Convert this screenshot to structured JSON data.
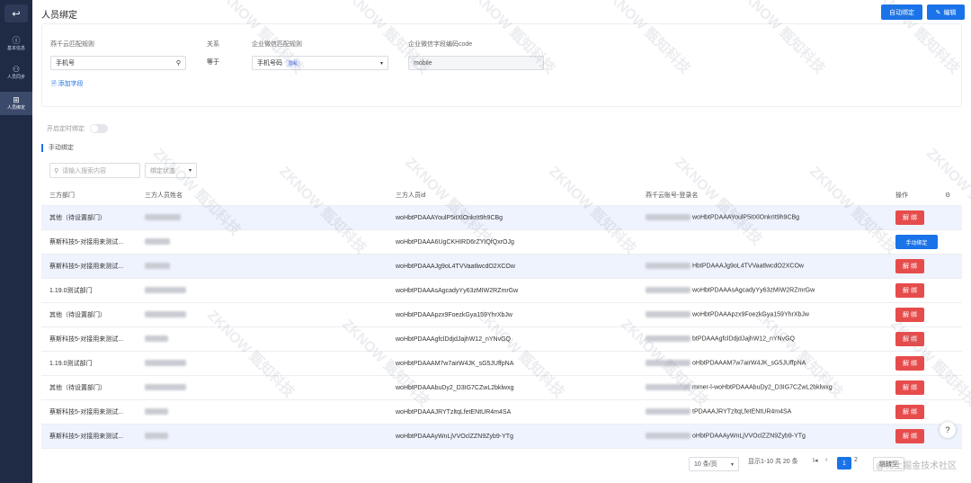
{
  "rail": {
    "back_icon": "↩",
    "items": [
      {
        "icon": "ⓘ",
        "label": "基本信息"
      },
      {
        "icon": "⚇",
        "label": "人员同步"
      },
      {
        "icon": "⊞",
        "label": "人员绑定"
      }
    ]
  },
  "header": {
    "title": "人员绑定",
    "auto_bind_label": "自动绑定",
    "edit_label": "编辑"
  },
  "rule": {
    "left_label": "燕千云匹配规则",
    "left_value": "手机号",
    "relation_label": "关系",
    "relation_value": "等于",
    "wecom_label": "企业微信匹配规则",
    "wecom_value": "手机号码",
    "wecom_tag": "隐私",
    "code_label": "企业微信字段编码code",
    "code_value": "mobile",
    "add_field_label": "添加字段"
  },
  "timer_label": "开启定时绑定",
  "section_title": "手动绑定",
  "filters": {
    "search_placeholder": "请输入搜索内容",
    "status_label": "绑定状态"
  },
  "table": {
    "headers": [
      "三方部门",
      "三方人员姓名",
      "三方人员id",
      "燕千云账号-登录名",
      "操作"
    ],
    "rows": [
      {
        "dept": "其他（待设置部门）",
        "name_w": 40,
        "id": "woHbtPDAAAYoulP5itXlOnkrIt9h9CBg",
        "acc_w": 50,
        "acc": "woHbtPDAAAYoulP5itXlOnkrIt9h9CBg",
        "action": "解 绑",
        "alt": true
      },
      {
        "dept": "蔡斯科技5-对接用来测试...",
        "name_w": 28,
        "id": "woHbtPDAAA6UgCKHIRD6rZYIQfQxrOJg",
        "acc_w": 0,
        "acc": "",
        "action": "手动绑定",
        "alt": false
      },
      {
        "dept": "蔡斯科技5-对接用来测试...",
        "name_w": 28,
        "id": "woHbtPDAAAJg9oL4TVVaatlwcdO2XCOw",
        "acc_w": 50,
        "acc": "HbtPDAAAJg9oL4TVVaatlwcdO2XCOw",
        "action": "解 绑",
        "alt": true
      },
      {
        "dept": "1.19.0测试部门",
        "name_w": 46,
        "id": "woHbtPDAAAsAgcadyYy63zMIW2RZmrGw",
        "acc_w": 50,
        "acc": "woHbtPDAAAsAgcadyYy63zMIW2RZmrGw",
        "action": "解 绑",
        "alt": false
      },
      {
        "dept": "其他（待设置部门）",
        "name_w": 46,
        "id": "woHbtPDAAApzx9FoezkGya159YhrXbJw",
        "acc_w": 50,
        "acc": "woHbtPDAAApzx9FoezkGya159YhrXbJw",
        "action": "解 绑",
        "alt": false
      },
      {
        "dept": "蔡斯科技5-对接用来测试...",
        "name_w": 26,
        "id": "woHbtPDAAAgfclDdjdJajhW12_nYNvGQ",
        "acc_w": 50,
        "acc": "btPDAAAgfclDdjdJajhW12_nYNvGQ",
        "action": "解 绑",
        "alt": false
      },
      {
        "dept": "1.19.0测试部门",
        "name_w": 46,
        "id": "woHbtPDAAAM7w7airW4JK_sG5JUffpNA",
        "acc_w": 50,
        "acc": "oHbtPDAAAM7w7airW4JK_sG5JUffpNA",
        "action": "解 绑",
        "alt": false
      },
      {
        "dept": "其他（待设置部门）",
        "name_w": 46,
        "id": "woHbtPDAAAbuDy2_D3IG7CZwL2bklwxg",
        "acc_w": 50,
        "acc": "mmer-l-woHbtPDAAAbuDy2_D3IG7CZwL2bklwxg",
        "action": "解 绑",
        "alt": false
      },
      {
        "dept": "蔡斯科技5-对接用来测试...",
        "name_w": 26,
        "id": "woHbtPDAAAJRYTzltqLfetENtUR4m4SA",
        "acc_w": 50,
        "acc": "tPDAAAJRYTzltqLfetENtUR4m4SA",
        "action": "解 绑",
        "alt": false
      },
      {
        "dept": "蔡斯科技5-对接用来测试...",
        "name_w": 26,
        "id": "woHbtPDAAAyWnLjVVOclZZN9Zyb9-YTg",
        "acc_w": 50,
        "acc": "oHbtPDAAAyWnLjVVOclZZN9Zyb9-YTg",
        "action": "解 绑",
        "alt": true
      }
    ]
  },
  "pager": {
    "page_size": "10 条/页",
    "total": "显示1-10 共 20 条",
    "first": "I◂",
    "prev": "‹",
    "current": "1",
    "next_page": "2",
    "jump": "跳转至"
  },
  "footer_mark": "@稀土掘金技术社区",
  "watermark": "ZKNOW 甄知科技"
}
